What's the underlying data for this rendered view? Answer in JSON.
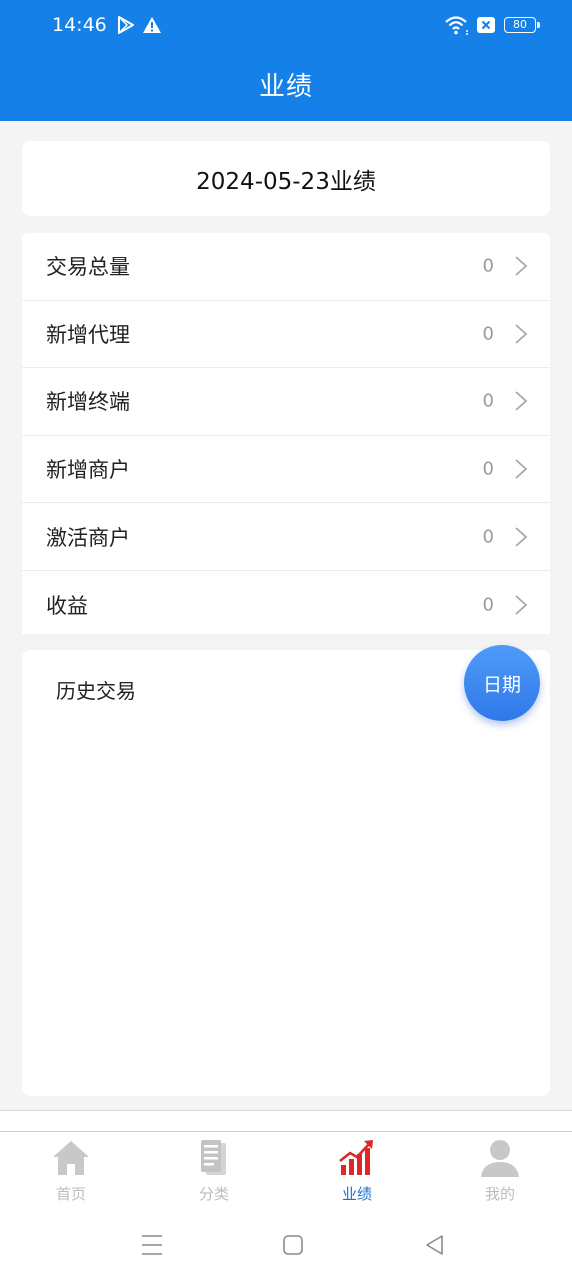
{
  "status_bar": {
    "time": "14:46",
    "battery": "80"
  },
  "header": {
    "title": "业绩"
  },
  "date_card": {
    "text": "2024-05-23业绩"
  },
  "stats": [
    {
      "label": "交易总量",
      "value": "0"
    },
    {
      "label": "新增代理",
      "value": "0"
    },
    {
      "label": "新增终端",
      "value": "0"
    },
    {
      "label": "新增商户",
      "value": "0"
    },
    {
      "label": "激活商户",
      "value": "0"
    },
    {
      "label": "收益",
      "value": "0"
    }
  ],
  "history": {
    "title": "历史交易",
    "date_button": "日期"
  },
  "tabbar": {
    "items": [
      {
        "label": "首页",
        "icon": "home-icon"
      },
      {
        "label": "分类",
        "icon": "document-icon"
      },
      {
        "label": "业绩",
        "icon": "chart-icon",
        "active": true
      },
      {
        "label": "我的",
        "icon": "user-icon"
      }
    ]
  },
  "colors": {
    "brand": "#1480e8",
    "active_tab": "#1b6fd0",
    "chart_icon": "#e02626",
    "inactive_icon": "#c8c8c8"
  }
}
